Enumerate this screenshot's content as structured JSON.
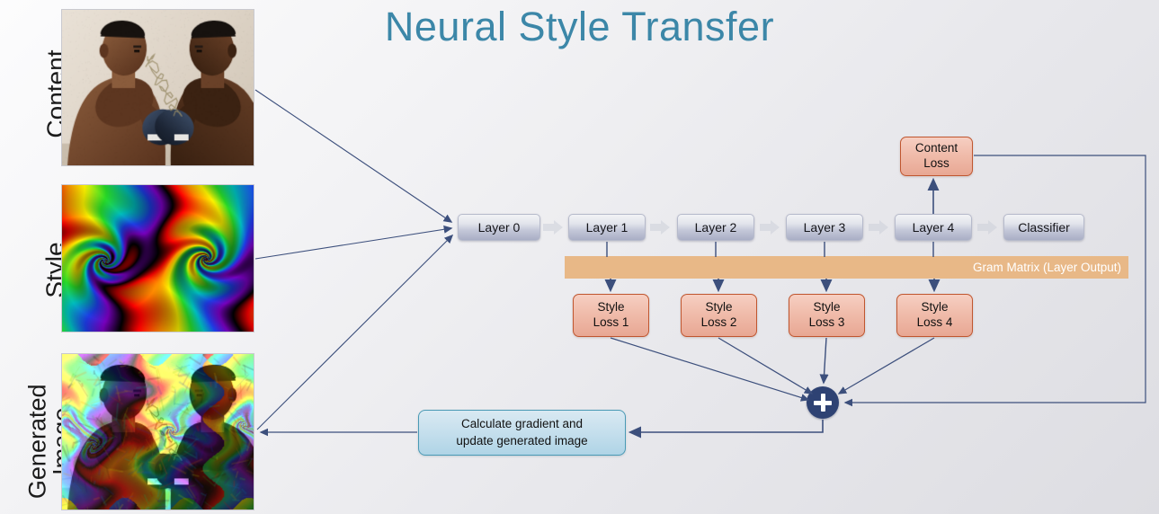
{
  "title": "Neural Style Transfer",
  "colors": {
    "title": "#3c87a8",
    "arrow": "#3c4f7c",
    "loss_border": "#c0562f",
    "loss_fill": "#efbdac",
    "gram_fill": "#e8b887",
    "calc_border": "#4a9ab5",
    "plus_node": "#2e4273",
    "layer_fill": "#c3c7d8",
    "background": "#e8e8ec"
  },
  "side_labels": [
    {
      "name": "content",
      "text": "Content"
    },
    {
      "name": "style",
      "text": "Style"
    },
    {
      "name": "generated",
      "text": "Generated\nImage"
    }
  ],
  "thumbnails": [
    {
      "name": "content-image",
      "alt": "Photograph of two boxers facing off"
    },
    {
      "name": "style-image",
      "alt": "Colorful rainbow fractal artwork"
    },
    {
      "name": "generated-image",
      "alt": "Stylized boxers image with fractal colors"
    }
  ],
  "network": {
    "layers": [
      {
        "label": "Layer 0"
      },
      {
        "label": "Layer 1"
      },
      {
        "label": "Layer 2"
      },
      {
        "label": "Layer 3"
      },
      {
        "label": "Layer 4"
      },
      {
        "label": "Classifier"
      }
    ]
  },
  "gram_bar": {
    "label": "Gram Matrix (Layer Output)"
  },
  "content_loss": {
    "line1": "Content",
    "line2": "Loss"
  },
  "style_losses": [
    {
      "line1": "Style",
      "line2": "Loss 1"
    },
    {
      "line1": "Style",
      "line2": "Loss 2"
    },
    {
      "line1": "Style",
      "line2": "Loss 3"
    },
    {
      "line1": "Style",
      "line2": "Loss 4"
    }
  ],
  "calc_box": {
    "line1": "Calculate gradient and",
    "line2": "update generated image"
  },
  "sum_node": {
    "symbol": "+"
  }
}
